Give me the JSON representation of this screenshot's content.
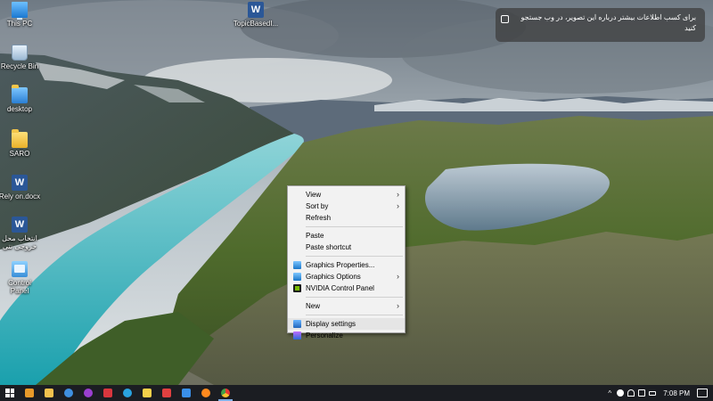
{
  "desktop": {
    "icons": [
      {
        "label": "This PC",
        "icon": "computer-icon"
      },
      {
        "label": "Recycle Bin",
        "icon": "recycle-bin-icon"
      },
      {
        "label": "desktop",
        "icon": "folder-icon"
      },
      {
        "label": "SARO",
        "icon": "folder-icon"
      },
      {
        "label": "Rely on.docx",
        "icon": "word-document-icon"
      },
      {
        "label": "انتخاب محل",
        "label2": "خروجی نتی",
        "icon": "word-document-icon"
      },
      {
        "label": "Control",
        "label2": "Panel",
        "icon": "control-panel-icon"
      },
      {
        "label": "TopicBasedI...",
        "icon": "word-document-icon"
      }
    ]
  },
  "notification": {
    "line1": "برای کسب اطلاعات بیشتر درباره این تصویر، در وب جستجو",
    "line2": "کنید"
  },
  "context_menu": {
    "items": [
      {
        "label": "View",
        "submenu": true
      },
      {
        "label": "Sort by",
        "submenu": true
      },
      {
        "label": "Refresh"
      },
      {
        "label": "Paste"
      },
      {
        "label": "Paste shortcut"
      },
      {
        "label": "Graphics Properties...",
        "icon": "intel-graphics-icon"
      },
      {
        "label": "Graphics Options",
        "icon": "intel-graphics-icon",
        "submenu": true
      },
      {
        "label": "NVIDIA Control Panel",
        "icon": "nvidia-icon"
      },
      {
        "label": "New",
        "submenu": true
      },
      {
        "label": "Display settings",
        "icon": "display-icon",
        "highlighted": true
      },
      {
        "label": "Personalize",
        "icon": "personalize-icon"
      }
    ],
    "submenu_arrow": "›"
  },
  "taskbar": {
    "apps": [
      {
        "icon": "media-player-icon",
        "color": "#e89a2a"
      },
      {
        "icon": "file-explorer-icon",
        "color": "#f2c14e"
      },
      {
        "icon": "edge-icon",
        "color": "#3f8fe0"
      },
      {
        "icon": "app-purple-icon",
        "color": "#9b3fd0"
      },
      {
        "icon": "app-red-icon",
        "color": "#d9363e"
      },
      {
        "icon": "telegram-icon",
        "color": "#2aa3e0"
      },
      {
        "icon": "sticky-notes-icon",
        "color": "#f5d04a"
      },
      {
        "icon": "pdf-icon",
        "color": "#e04040"
      },
      {
        "icon": "shield-app-icon",
        "color": "#3a8fe8"
      },
      {
        "icon": "firefox-icon",
        "color": "#ff8a1e"
      },
      {
        "icon": "chrome-icon",
        "color": "#4caf50",
        "active": true
      }
    ],
    "tray": {
      "time": "7:08 PM",
      "icons": [
        "chevron-up-icon",
        "network-icon",
        "volume-icon",
        "battery-icon",
        "keyboard-icon"
      ]
    }
  },
  "colors": {
    "taskbar": "#1b1d22",
    "menu_bg": "#f2f2f2",
    "menu_highlight": "#e5e5e5"
  }
}
